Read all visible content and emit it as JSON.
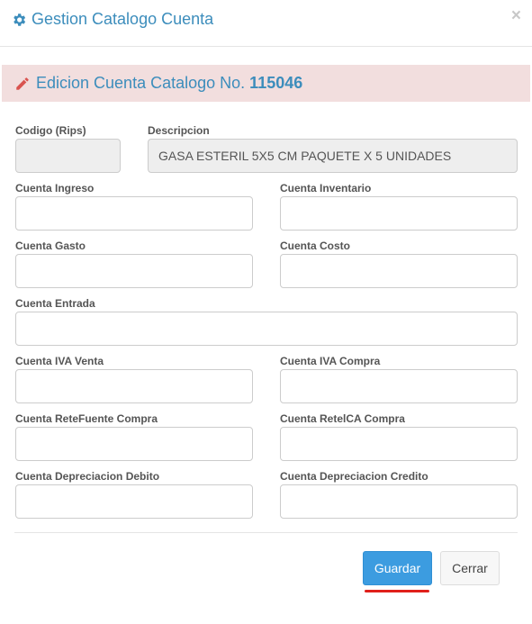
{
  "header": {
    "title": "Gestion Catalogo Cuenta",
    "close_label": "×"
  },
  "banner": {
    "text": "Edicion Cuenta Catalogo No.",
    "number": "115046"
  },
  "fields": {
    "codigo": {
      "label": "Codigo (Rips)",
      "value": ""
    },
    "descripcion": {
      "label": "Descripcion",
      "value": "GASA ESTERIL 5X5 CM PAQUETE X 5 UNIDADES"
    },
    "cuenta_ingreso": {
      "label": "Cuenta Ingreso",
      "value": ""
    },
    "cuenta_inventario": {
      "label": "Cuenta Inventario",
      "value": ""
    },
    "cuenta_gasto": {
      "label": "Cuenta Gasto",
      "value": ""
    },
    "cuenta_costo": {
      "label": "Cuenta Costo",
      "value": ""
    },
    "cuenta_entrada": {
      "label": "Cuenta Entrada",
      "value": ""
    },
    "cuenta_iva_venta": {
      "label": "Cuenta IVA Venta",
      "value": ""
    },
    "cuenta_iva_compra": {
      "label": "Cuenta IVA Compra",
      "value": ""
    },
    "cuenta_retefuente_compra": {
      "label": "Cuenta ReteFuente Compra",
      "value": ""
    },
    "cuenta_reteica_compra": {
      "label": "Cuenta RetelCA Compra",
      "value": ""
    },
    "cuenta_depreciacion_debito": {
      "label": "Cuenta Depreciacion Debito",
      "value": ""
    },
    "cuenta_depreciacion_credito": {
      "label": "Cuenta Depreciacion Credito",
      "value": ""
    }
  },
  "buttons": {
    "save_label": "Guardar",
    "close_label": "Cerrar"
  },
  "colors": {
    "accent": "#3c8dbc",
    "banner_bg": "#f2dede",
    "primary_button": "#3c9ce0",
    "focus_underline": "#e0201b"
  }
}
